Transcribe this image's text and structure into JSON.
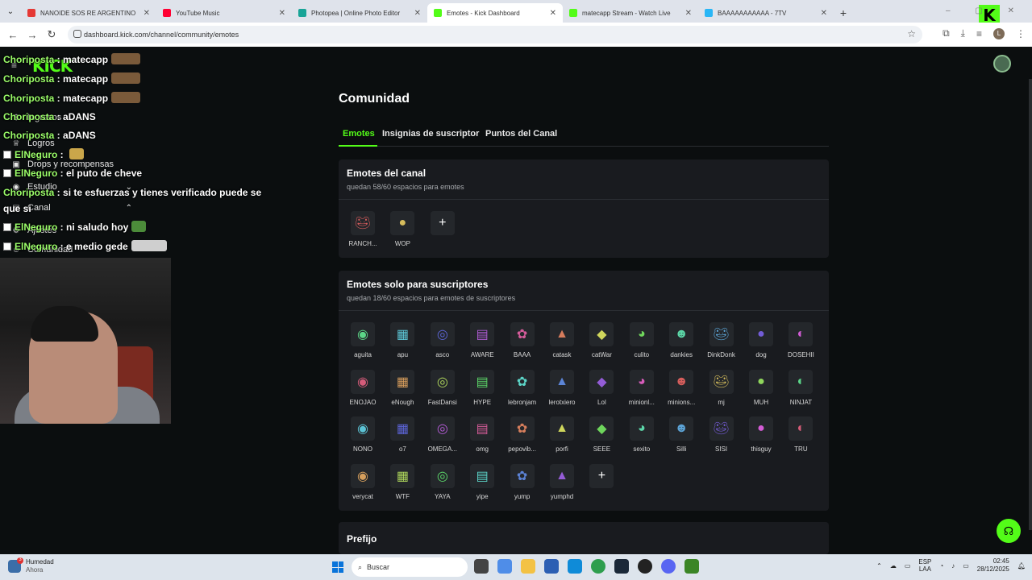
{
  "browser": {
    "tabs": [
      {
        "title": "NANOIDE SOS RE ARGENTINO",
        "color": "#e53935",
        "active": false
      },
      {
        "title": "YouTube Music",
        "color": "#ff0033",
        "active": false
      },
      {
        "title": "Photopea | Online Photo Editor",
        "color": "#18a497",
        "active": false
      },
      {
        "title": "Emotes - Kick Dashboard",
        "color": "#53fc18",
        "active": true
      },
      {
        "title": "matecapp Stream - Watch Live",
        "color": "#53fc18",
        "active": false
      },
      {
        "title": "BAAAAAAAAAAA - 7TV",
        "color": "#29b6f6",
        "active": false
      }
    ],
    "url": "dashboard.kick.com/channel/community/emotes",
    "profile_initial": "L"
  },
  "sidebar": {
    "logo": "KICK",
    "items": [
      {
        "label": "Ingresos",
        "icon": "dollar-icon"
      },
      {
        "label": "Logros",
        "icon": "trophy-icon"
      },
      {
        "label": "Drops y recompensas",
        "icon": "gift-icon"
      },
      {
        "label": "Estudio",
        "icon": "studio-icon"
      },
      {
        "label": "Canal",
        "icon": "channel-icon"
      },
      {
        "label": "Ajustes",
        "icon": "settings-icon"
      },
      {
        "label": "Comunidad",
        "icon": "community-icon"
      }
    ]
  },
  "chat": [
    {
      "user": "Choriposta",
      "msg": "matecapp",
      "box": false
    },
    {
      "user": "Choriposta",
      "msg": "matecapp",
      "box": false
    },
    {
      "user": "Choriposta",
      "msg": "matecapp",
      "box": false
    },
    {
      "user": "Choriposta",
      "msg": "aDANS",
      "box": false
    },
    {
      "user": "Choriposta",
      "msg": "aDANS",
      "box": false
    },
    {
      "user": "ElNeguro",
      "msg": "",
      "box": true
    },
    {
      "user": "ElNeguro",
      "msg": "el puto de cheve",
      "box": true
    },
    {
      "user": "Choriposta",
      "msg": "si te esfuerzas y tienes verificado puede se",
      "box": false
    },
    {
      "user": "",
      "msg": "que si",
      "box": false
    },
    {
      "user": "ElNeguro",
      "msg": "ni saludo hoy",
      "box": true
    },
    {
      "user": "ElNeguro",
      "msg": "e medio gede",
      "box": true
    }
  ],
  "page": {
    "title": "Comunidad",
    "tabs": [
      "Emotes",
      "Insignias de suscriptor",
      "Puntos del Canal"
    ],
    "channel_card": {
      "title": "Emotes del canal",
      "subtitle": "quedan 58/60 espacios para emotes"
    },
    "channel_emotes": [
      "RANCH...",
      "WOP"
    ],
    "sub_card": {
      "title": "Emotes solo para suscriptores",
      "subtitle": "quedan 18/60 espacios para emotes de suscriptores"
    },
    "sub_emotes": [
      "aguita",
      "apu",
      "asco",
      "AWARE",
      "BAAA",
      "catask",
      "catWar",
      "culito",
      "dankies",
      "DinkDonk",
      "dog",
      "DOSEHII",
      "ENOJAO",
      "eNough",
      "FastDansi",
      "HYPE",
      "lebronjam",
      "lerotxiero",
      "Lol",
      "minionl...",
      "minions...",
      "mj",
      "MUH",
      "NINJAT",
      "NONO",
      "o7",
      "OMEGA...",
      "omg",
      "pepovib...",
      "porfi",
      "SEEE",
      "sexito",
      "Silli",
      "SISI",
      "thisguy",
      "TRU",
      "verycat",
      "WTF",
      "YAYA",
      "yipe",
      "yump",
      "yumphd"
    ],
    "prefix_title": "Prefijo",
    "add_symbol": "+"
  },
  "taskbar": {
    "weather_title": "Humedad",
    "weather_sub": "Ahora",
    "badge": "3",
    "search": "Buscar",
    "lang1": "ESP",
    "lang2": "LAA",
    "time": "02:45",
    "date": "28/12/2025"
  },
  "colors": {
    "accent": "#53fc18",
    "card": "#191b1f",
    "bg": "#0b0e0f"
  }
}
